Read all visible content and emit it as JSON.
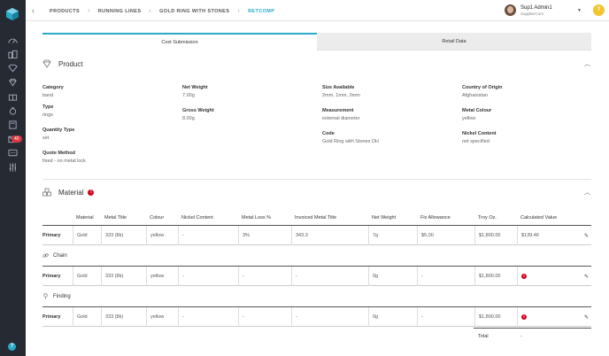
{
  "breadcrumbs": [
    "PRODUCTS",
    "RUNNING LINES",
    "GOLD RING WITH STONES",
    "RETCOMP"
  ],
  "user": {
    "name": "Sup1 Admin1",
    "company": "SupplierCom",
    "help": "?"
  },
  "sidebar": {
    "badge": "40",
    "help": "?"
  },
  "tabs": [
    "Cost Submission",
    "Retail Data"
  ],
  "product": {
    "title": "Product",
    "fields": [
      {
        "label": "Category",
        "value": "band"
      },
      {
        "label": "Type",
        "value": "rings"
      },
      {
        "label": "Quantity Type",
        "value": "set"
      },
      {
        "label": "Quote Method",
        "value": "fixed - no metal lock"
      },
      {
        "label": "Net Weight",
        "value": "7.00g"
      },
      {
        "label": "Gross Weight",
        "value": "8.00g"
      },
      {
        "label": "Size Available",
        "value": "2mm, 1mm, 3mm"
      },
      {
        "label": "Measurement",
        "value": "external diameter"
      },
      {
        "label": "Code",
        "value": "Gold Ring with Stones DH"
      },
      {
        "label": "Country of Origin",
        "value": "Afghanistan"
      },
      {
        "label": "Metal Colour",
        "value": "yellow"
      },
      {
        "label": "Nickel Content",
        "value": "not specified"
      }
    ]
  },
  "material": {
    "title": "Material",
    "alert": "!",
    "headers": [
      "Material",
      "Metal Title",
      "Colour",
      "Nickel Content",
      "Metal Loss %",
      "Invoiced Metal Title",
      "Net Weight",
      "Fix Allowance",
      "Troy Oz.",
      "Calculated Value"
    ],
    "rows": [
      {
        "group": "",
        "cells": [
          "Primary",
          "Gold",
          "333 (8k)",
          "yellow",
          "-",
          "3%",
          "343.3",
          "7g",
          "$5.00",
          "$1,800.00",
          "$139.46"
        ]
      },
      {
        "group": "Chain",
        "cells": [
          "Primary",
          "Gold",
          "333 (8k)",
          "yellow",
          "-",
          "-",
          "-",
          "0g",
          "-",
          "$1,800.00",
          ""
        ]
      },
      {
        "group": "Finding",
        "cells": [
          "Primary",
          "Gold",
          "333 (8k)",
          "yellow",
          "-",
          "-",
          "-",
          "0g",
          "-",
          "$1,800.00",
          ""
        ]
      }
    ],
    "total_label": "Total",
    "total_value": "-"
  },
  "colors": {
    "accent": "#2aa9c9",
    "sidebar": "#252a33",
    "error": "#d0021b",
    "help": "#f4c430"
  }
}
